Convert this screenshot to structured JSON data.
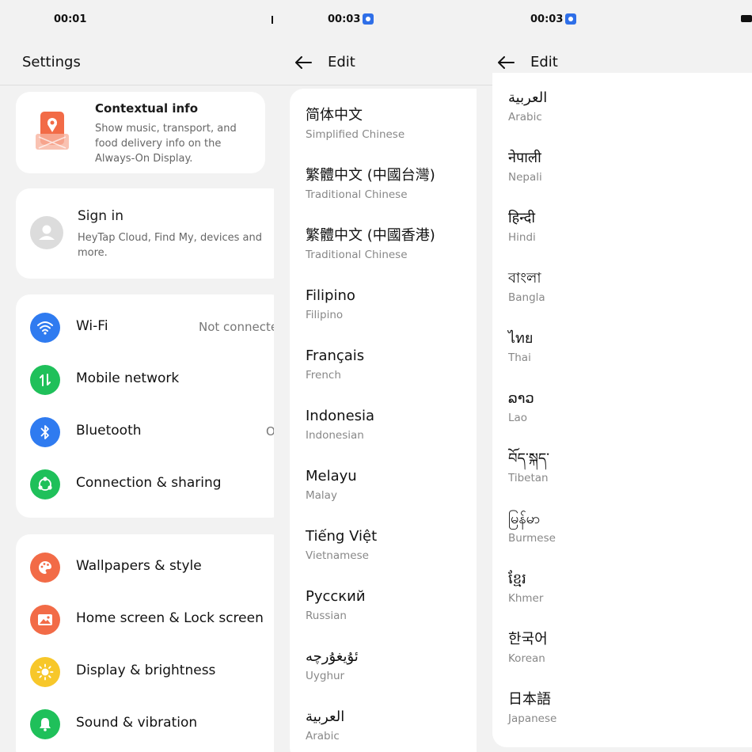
{
  "panel1": {
    "status_time": "00:01",
    "title": "Settings",
    "contextual": {
      "title": "Contextual info",
      "description": "Show music, transport, and food delivery info on the Always-On Display."
    },
    "signin": {
      "title": "Sign in",
      "description": "HeyTap Cloud, Find My, devices and more."
    },
    "network": [
      {
        "label": "Wi-Fi",
        "value": "Not connecte",
        "icon": "wifi-icon",
        "color": "#2f7bf0"
      },
      {
        "label": "Mobile network",
        "value": "",
        "icon": "mobile-network-icon",
        "color": "#1fc05a"
      },
      {
        "label": "Bluetooth",
        "value": "O",
        "icon": "bluetooth-icon",
        "color": "#2f7bf0"
      },
      {
        "label": "Connection & sharing",
        "value": "",
        "icon": "connection-sharing-icon",
        "color": "#1fc05a"
      }
    ],
    "personal": [
      {
        "label": "Wallpapers & style",
        "icon": "palette-icon",
        "color": "#f26b47"
      },
      {
        "label": "Home screen & Lock screen",
        "icon": "image-icon",
        "color": "#f26b47"
      },
      {
        "label": "Display & brightness",
        "icon": "sun-icon",
        "color": "#f7c72a"
      },
      {
        "label": "Sound & vibration",
        "icon": "bell-icon",
        "color": "#1fc05a"
      }
    ]
  },
  "panel2": {
    "status_time": "00:03",
    "title": "Edit",
    "languages": [
      {
        "native": "简体中文",
        "english": "Simplified Chinese"
      },
      {
        "native": "繁體中文 (中國台灣)",
        "english": "Traditional Chinese"
      },
      {
        "native": "繁體中文 (中國香港)",
        "english": "Traditional Chinese"
      },
      {
        "native": "Filipino",
        "english": "Filipino"
      },
      {
        "native": "Français",
        "english": "French"
      },
      {
        "native": "Indonesia",
        "english": "Indonesian"
      },
      {
        "native": "Melayu",
        "english": "Malay"
      },
      {
        "native": "Tiếng Việt",
        "english": "Vietnamese"
      },
      {
        "native": "Русский",
        "english": "Russian"
      },
      {
        "native": "ئۇيغۇرچە",
        "english": "Uyghur"
      },
      {
        "native": "العربية",
        "english": "Arabic"
      }
    ]
  },
  "panel3": {
    "status_time": "00:03",
    "title": "Edit",
    "languages": [
      {
        "native": "العربية",
        "english": "Arabic"
      },
      {
        "native": "नेपाली",
        "english": "Nepali"
      },
      {
        "native": "हिन्दी",
        "english": "Hindi"
      },
      {
        "native": "বাংলা",
        "english": "Bangla"
      },
      {
        "native": "ไทย",
        "english": "Thai"
      },
      {
        "native": "ລາວ",
        "english": "Lao"
      },
      {
        "native": "བོད་སྐད་",
        "english": "Tibetan"
      },
      {
        "native": "မြန်မာ",
        "english": "Burmese"
      },
      {
        "native": "ខ្មែរ",
        "english": "Khmer"
      },
      {
        "native": "한국어",
        "english": "Korean"
      },
      {
        "native": "日本語",
        "english": "Japanese"
      }
    ]
  }
}
